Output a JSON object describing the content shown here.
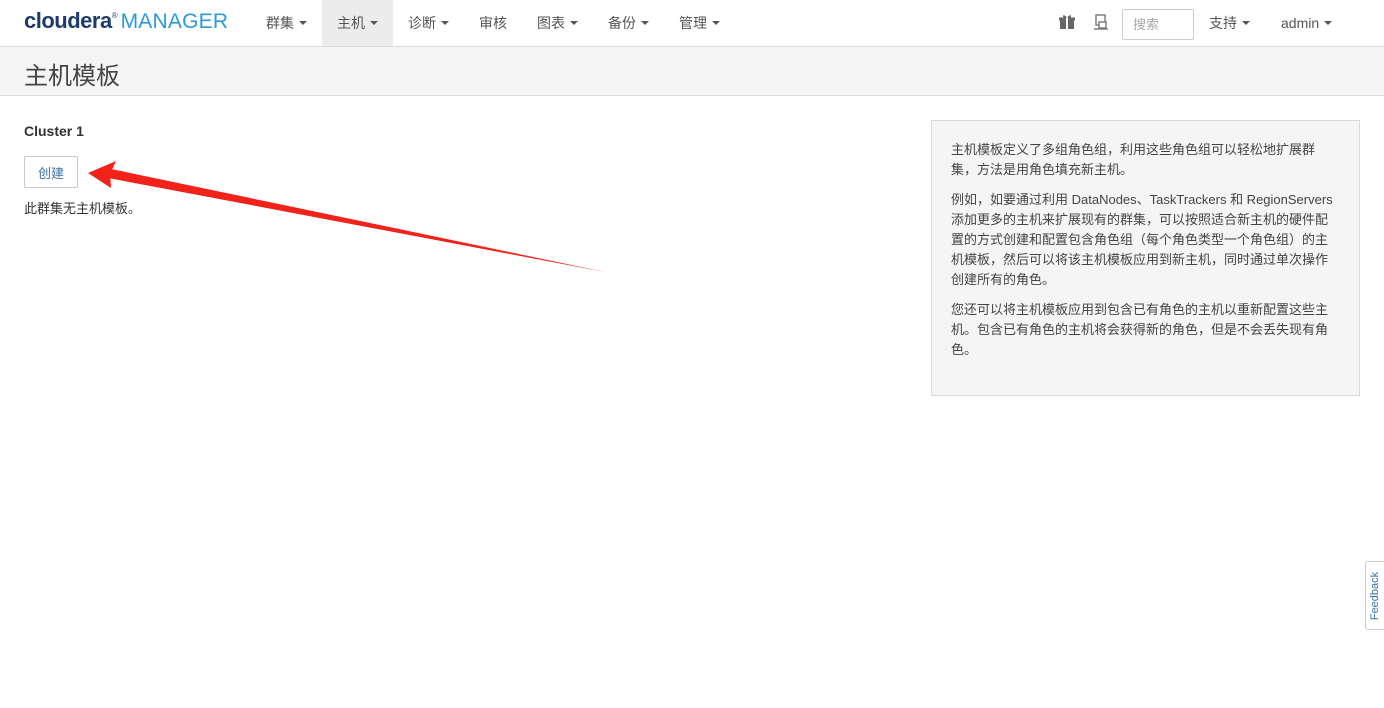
{
  "brand": {
    "name": "cloudera",
    "registered": "®",
    "product": "MANAGER"
  },
  "nav": {
    "items": [
      {
        "label": "群集",
        "dropdown": true,
        "active": false
      },
      {
        "label": "主机",
        "dropdown": true,
        "active": true
      },
      {
        "label": "诊断",
        "dropdown": true,
        "active": false
      },
      {
        "label": "审核",
        "dropdown": false,
        "active": false
      },
      {
        "label": "图表",
        "dropdown": true,
        "active": false
      },
      {
        "label": "备份",
        "dropdown": true,
        "active": false
      },
      {
        "label": "管理",
        "dropdown": true,
        "active": false
      }
    ],
    "icons": [
      "gift-icon",
      "parcels-icon"
    ],
    "search_placeholder": "搜索",
    "support_label": "支持",
    "user_label": "admin"
  },
  "page": {
    "title": "主机模板"
  },
  "cluster": {
    "name": "Cluster 1",
    "create_label": "创建",
    "empty_message": "此群集无主机模板。"
  },
  "info": {
    "paragraphs": [
      "主机模板定义了多组角色组，利用这些角色组可以轻松地扩展群集，方法是用角色填充新主机。",
      "例如，如要通过利用 DataNodes、TaskTrackers 和 RegionServers 添加更多的主机来扩展现有的群集，可以按照适合新主机的硬件配置的方式创建和配置包含角色组（每个角色类型一个角色组）的主机模板，然后可以将该主机模板应用到新主机，同时通过单次操作创建所有的角色。",
      "您还可以将主机模板应用到包含已有角色的主机以重新配置这些主机。包含已有角色的主机将会获得新的角色，但是不会丢失现有角色。"
    ]
  },
  "feedback": {
    "label": "Feedback"
  },
  "annotation": {
    "color": "#f0221a",
    "icon": "red-arrow"
  },
  "colors": {
    "brand_dark": "#1e3c6b",
    "brand_light": "#2b9bd6",
    "link": "#3b73a6"
  }
}
